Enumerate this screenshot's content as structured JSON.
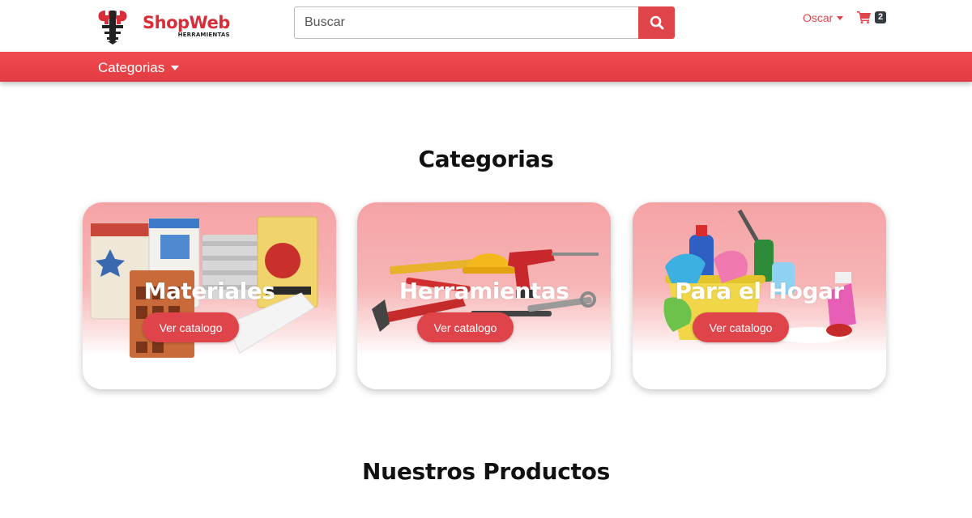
{
  "header": {
    "logo_name": "ShopWeb",
    "logo_sub": "HERRAMIENTAS",
    "search_placeholder": "Buscar",
    "user_name": "Oscar",
    "cart_count": "2"
  },
  "nav": {
    "categories_label": "Categorias"
  },
  "main": {
    "categories_title": "Categorias",
    "products_title": "Nuestros Productos",
    "cards": [
      {
        "title": "Materiales",
        "button": "Ver catalogo"
      },
      {
        "title": "Herramientas",
        "button": "Ver catalogo"
      },
      {
        "title": "Para el Hogar",
        "button": "Ver catalogo"
      }
    ]
  },
  "colors": {
    "brand_red": "#e0444b",
    "card_pink": "#f5a3a5"
  },
  "icons": [
    "wrench-logo-icon",
    "search-icon",
    "caret-down-icon",
    "cart-icon"
  ]
}
